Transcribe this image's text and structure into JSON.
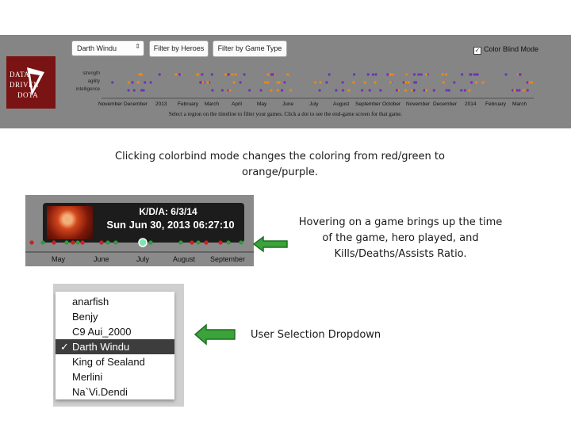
{
  "header": {
    "logo_lines": [
      "DATA",
      "DRIVEN",
      "DOTA"
    ],
    "user_select": {
      "value": "Darth Windu"
    },
    "filter_heroes_label": "Filter by Heroes",
    "filter_game_type_label": "Filter by Game Type",
    "color_blind_label": "Color Blind Mode",
    "color_blind_checked": true
  },
  "timeline": {
    "row_labels": [
      "strength",
      "agility",
      "intelligence"
    ],
    "months": [
      "November",
      "December",
      "2013",
      "February",
      "March",
      "April",
      "May",
      "June",
      "July",
      "August",
      "September",
      "October",
      "November",
      "December",
      "2014",
      "February",
      "March"
    ],
    "caption": "Select a region on the timeline to filter your games. Click a dot to see the end-game screen for that game.",
    "colors": {
      "win": "#e8891e",
      "loss": "#6b34b3"
    }
  },
  "captions": {
    "colorblind": "Clicking colorbind mode changes the coloring from red/green to orange/purple.",
    "hover": "Hovering on a game brings up the time of the game, hero played, and Kills/Deaths/Assists Ratio.",
    "dropdown": "User Selection Dropdown"
  },
  "tooltip": {
    "kda": "K/D/A: 6/3/14",
    "date": "Sun Jun 30, 2013 06:27:10",
    "months": [
      "May",
      "June",
      "July",
      "August",
      "September"
    ],
    "colors": {
      "win": "#2e9a3a",
      "loss": "#d01f1f",
      "highlight": "#7fe3b4"
    }
  },
  "dropdown": {
    "items": [
      "anarfish",
      "Benjy",
      "C9 Aui_2000",
      "Darth Windu",
      "King of Sealand",
      "Merlini",
      "Na`Vi.Dendi"
    ],
    "selected_index": 3,
    "check_mark": "✓"
  },
  "arrow_color": "#2f9a30"
}
